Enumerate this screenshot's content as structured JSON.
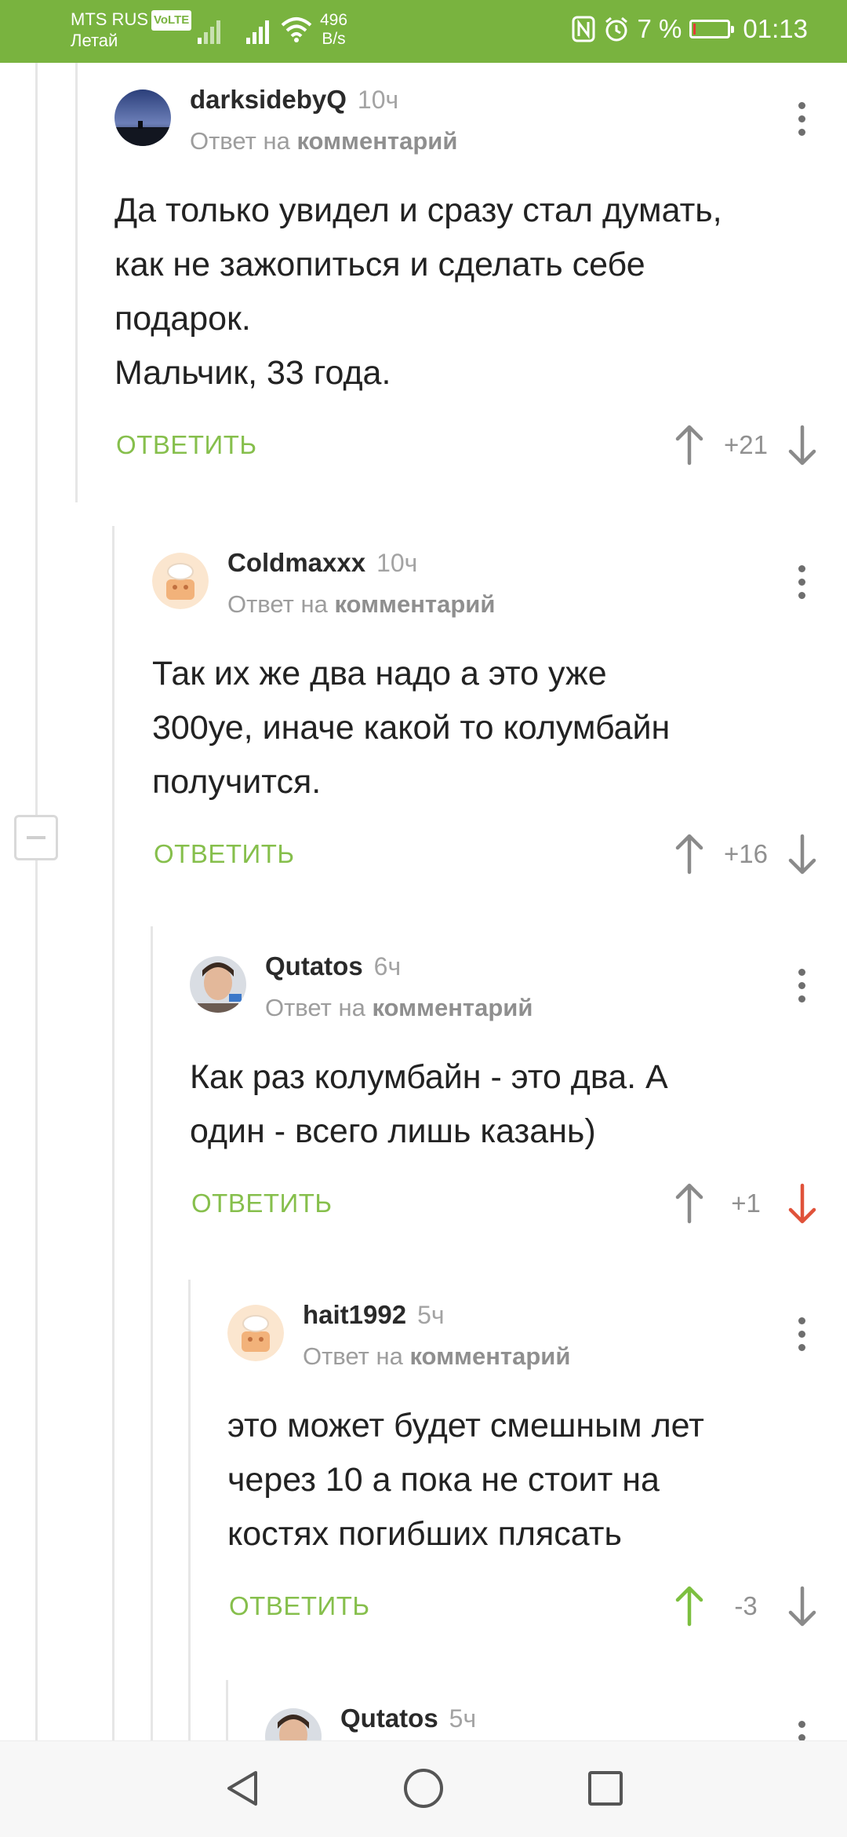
{
  "status_bar": {
    "carrier": "MTS RUS",
    "volte": "VoLTE",
    "operator": "Летай",
    "speed_value": "496",
    "speed_unit": "B/s",
    "battery": "7 %",
    "battery_level": 0.07,
    "time": "01:13"
  },
  "comments": [
    {
      "username": "darksidebyQ",
      "time": "10ч",
      "reply_prefix": "Ответ на",
      "reply_link": "комментарий",
      "text": "Да только увидел и сразу стал думать,\nкак не зажопиться и сделать себе\nподарок.\nМальчик, 33 года.",
      "reply_label": "ОТВЕТИТЬ",
      "score": "+21",
      "avatar_icon": "sunset-avatar",
      "voted": "none"
    },
    {
      "username": "Coldmaxxx",
      "time": "10ч",
      "reply_prefix": "Ответ на",
      "reply_link": "комментарий",
      "text": "Так их же два надо а это уже\n300уе, иначе какой то колумбайн\nполучится.",
      "reply_label": "ОТВЕТИТЬ",
      "score": "+16",
      "avatar_icon": "default-chef-avatar",
      "voted": "none"
    },
    {
      "username": "Qutatos",
      "time": "6ч",
      "reply_prefix": "Ответ на",
      "reply_link": "комментарий",
      "text": "Как раз колумбайн - это два. А\nодин - всего лишь казань)",
      "reply_label": "ОТВЕТИТЬ",
      "score": "+1",
      "avatar_icon": "photo-avatar",
      "voted": "down"
    },
    {
      "username": "hait1992",
      "time": "5ч",
      "reply_prefix": "Ответ на",
      "reply_link": "комментарий",
      "text": "это может будет смешным лет\nчерез 10 а пока не стоит на\nкостях погибших плясать",
      "reply_label": "ОТВЕТИТЬ",
      "score": "-3",
      "avatar_icon": "default-chef-avatar",
      "voted": "up"
    },
    {
      "username": "Qutatos",
      "time": "5ч",
      "avatar_icon": "photo-avatar"
    }
  ],
  "colors": {
    "accent": "#79b33f",
    "reply": "#86bf4c",
    "vote_up_active": "#7cbf3f",
    "vote_down_active": "#e0523a",
    "vote_neutral": "#8a8a8a"
  },
  "navbar": {
    "icons": [
      "back-icon",
      "home-icon",
      "recents-icon"
    ]
  }
}
